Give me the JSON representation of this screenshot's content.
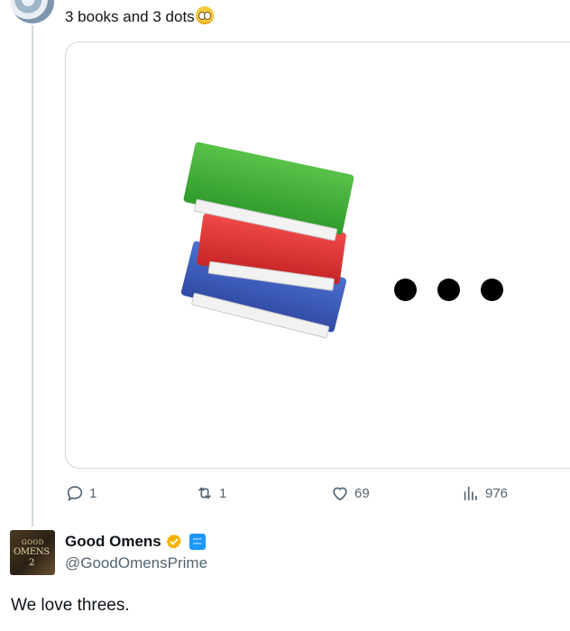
{
  "parent_tweet": {
    "text": "3 books and 3 dots",
    "emoji": "pleading-face-emoji",
    "media": {
      "description_icons": [
        "books-emoji",
        "ellipsis-dots"
      ]
    },
    "actions": {
      "replies": "1",
      "reposts": "1",
      "likes": "69",
      "views": "976"
    }
  },
  "reply_tweet": {
    "display_name": "Good Omens",
    "handle": "@GoodOmensPrime",
    "text": "We love threes.",
    "avatar_text": [
      "GOOD",
      "OMENS",
      "2"
    ],
    "affiliate_badge_text": "prime video"
  },
  "colors": {
    "text": "#0f1419",
    "muted": "#536471",
    "border": "#cfd9de",
    "gold_badge": "#f5b301",
    "affiliate_blue": "#1a98ff"
  }
}
